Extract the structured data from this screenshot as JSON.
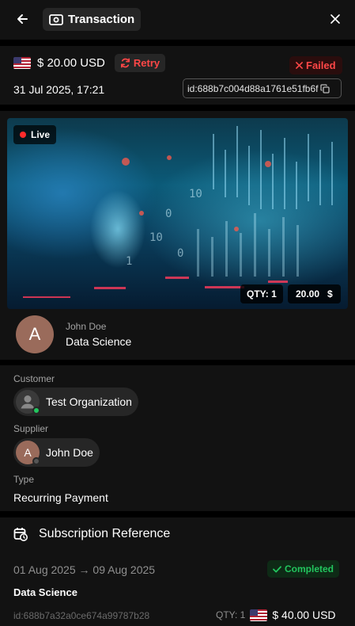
{
  "header": {
    "title": "Transaction"
  },
  "transaction": {
    "amount": "$ 20.00 USD",
    "retry_label": "Retry",
    "status_label": "Failed",
    "datetime": "31 Jul 2025, 17:21",
    "id_label": "id:688b7c004d88a1761e51fb6f"
  },
  "product": {
    "live_label": "Live",
    "qty_label": "QTY: 1",
    "price_value": "20.00",
    "price_currency": "$",
    "owner": "John Doe",
    "name": "Data Science",
    "avatar_letter": "A"
  },
  "parties": {
    "customer_label": "Customer",
    "customer_name": "Test Organization",
    "supplier_label": "Supplier",
    "supplier_name": "John Doe",
    "supplier_initial": "A",
    "type_label": "Type",
    "type_value": "Recurring Payment"
  },
  "subscription": {
    "title": "Subscription Reference",
    "date_range": "01 Aug 2025 → 09 Aug 2025",
    "status_label": "Completed",
    "name": "Data Science",
    "id_label": "id:688b7a32a0ce674a99787b28",
    "qty_label": "QTY: 1",
    "amount": "$ 40.00 USD"
  },
  "colors": {
    "background": "#000000",
    "card": "#121212",
    "danger": "#ff4747",
    "success": "#22c55e",
    "online": "#22c55e"
  }
}
